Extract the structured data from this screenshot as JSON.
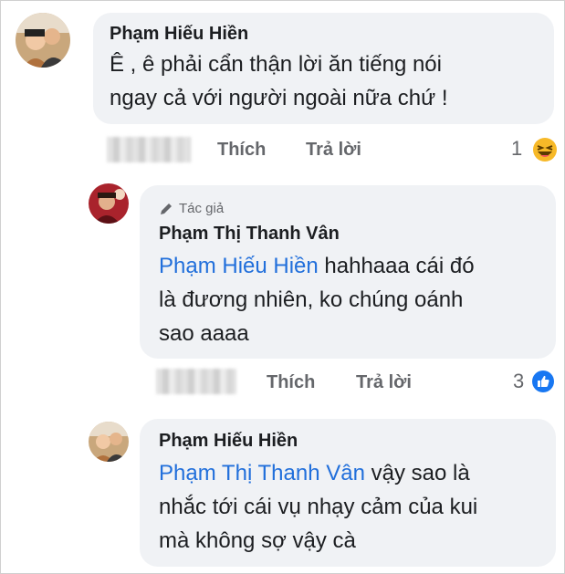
{
  "comments": [
    {
      "author": "Phạm Hiếu Hiền",
      "lines": [
        "Ê , ê phải cẩn thận lời ăn tiếng nói",
        "ngay cả với người ngoài nữa chứ !"
      ],
      "actions": {
        "like": "Thích",
        "reply": "Trả lời"
      },
      "reaction": {
        "count": "1",
        "icon": "haha-icon"
      }
    },
    {
      "author_badge": "Tác giả",
      "author": "Phạm Thị Thanh Vân",
      "mention": "Phạm Hiếu Hiền",
      "lines": [
        " hahhaaa cái đó",
        "là đương nhiên, ko chúng oánh",
        "sao aaaa"
      ],
      "actions": {
        "like": "Thích",
        "reply": "Trả lời"
      },
      "reaction": {
        "count": "3",
        "icon": "like-icon"
      }
    },
    {
      "author": "Phạm Hiếu Hiền",
      "mention": "Phạm Thị Thanh Vân",
      "lines": [
        " vậy sao là",
        "nhắc tới cái vụ nhạy cảm của kui",
        "mà không sợ vậy cà"
      ]
    }
  ],
  "colors": {
    "bubble": "#f0f2f5",
    "mention": "#216fdb",
    "meta": "#65676b",
    "like": "#1877f2",
    "haha": "#f7b928"
  }
}
